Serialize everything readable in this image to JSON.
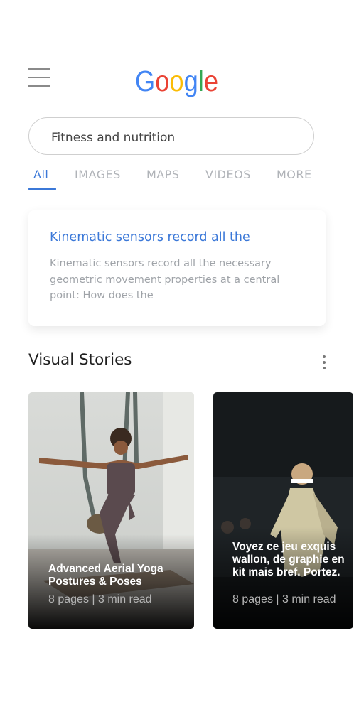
{
  "logo": {
    "text": "Google"
  },
  "search": {
    "value": "Fitness and nutrition"
  },
  "tabs": [
    {
      "label": "All",
      "active": true
    },
    {
      "label": "IMAGES"
    },
    {
      "label": "MAPS"
    },
    {
      "label": "VIDEOS"
    },
    {
      "label": "MORE"
    }
  ],
  "result": {
    "title": "Kinematic sensors record all the",
    "snippet": "Kinematic sensors record all the necessary geometric movement properties at a central point: How does the"
  },
  "visual_stories": {
    "heading": "Visual Stories",
    "stories": [
      {
        "title": "Advanced Aerial Yoga Postures & Poses",
        "meta": "8 pages | 3 min read"
      },
      {
        "title": "Voyez ce jeu exquis wallon, de graphie en kit mais bref. Portez.",
        "meta": "8 pages | 3 min read"
      }
    ]
  },
  "colors": {
    "accent": "#3b78d8",
    "logo_blue": "#4285F4",
    "logo_red": "#EA4335",
    "logo_yellow": "#FBBC05",
    "logo_green": "#34A853"
  },
  "icons": [
    "hamburger-menu-icon",
    "more-vertical-icon"
  ]
}
